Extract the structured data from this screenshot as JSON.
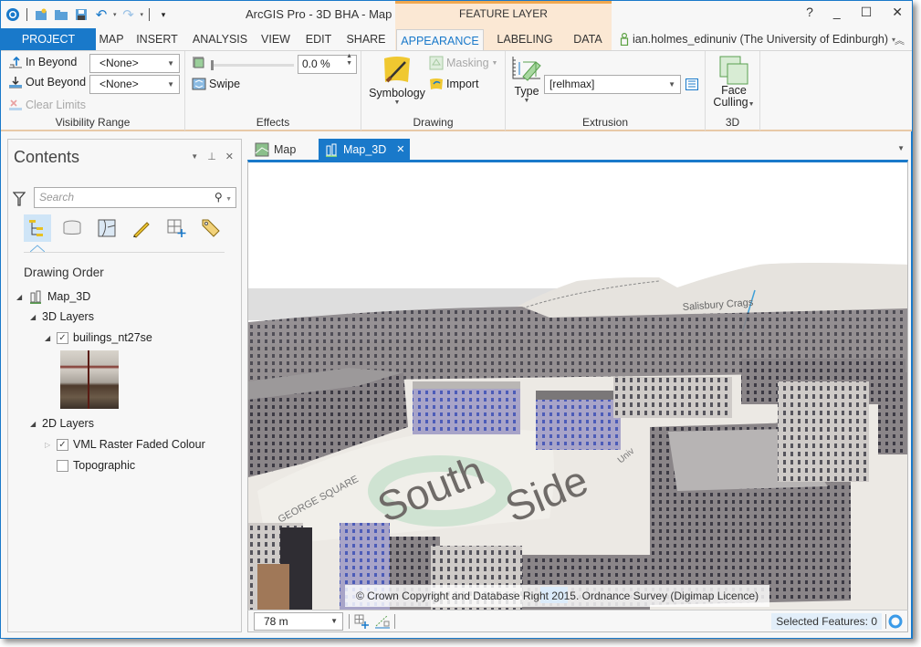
{
  "window": {
    "title": "ArcGIS Pro - 3D BHA - Map",
    "contextual_tab_group": "FEATURE LAYER",
    "controls": {
      "help": "?",
      "minimize": "_",
      "maximize": "☐",
      "close": "✕"
    },
    "qat_icons": [
      "arcgis-logo-icon",
      "new-project-icon",
      "open-project-icon",
      "save-project-icon",
      "undo-icon",
      "redo-icon",
      "customize-qat-icon"
    ]
  },
  "ribbon_tabs": [
    {
      "label": "PROJECT",
      "state": "project"
    },
    {
      "label": "MAP"
    },
    {
      "label": "INSERT"
    },
    {
      "label": "ANALYSIS"
    },
    {
      "label": "VIEW"
    },
    {
      "label": "EDIT"
    },
    {
      "label": "SHARE"
    },
    {
      "label": "APPEARANCE",
      "state": "active"
    },
    {
      "label": "LABELING"
    },
    {
      "label": "DATA"
    }
  ],
  "user": {
    "label": "ian.holmes_edinuniv (The University of Edinburgh)",
    "dropdown": "▾",
    "collapse": "︽"
  },
  "ribbon": {
    "visibility_range": {
      "label": "Visibility Range",
      "in_beyond": "In Beyond",
      "in_beyond_value": "<None>",
      "out_beyond": "Out Beyond",
      "out_beyond_value": "<None>",
      "clear_limits": "Clear Limits"
    },
    "effects": {
      "label": "Effects",
      "transparency_value": "0.0 %",
      "transparency_percent": 0,
      "swipe": "Swipe"
    },
    "drawing": {
      "label": "Drawing",
      "symbology": "Symbology",
      "masking": "Masking",
      "import": "Import"
    },
    "extrusion": {
      "label": "Extrusion",
      "type": "Type",
      "field_value": "[relhmax]"
    },
    "three_d": {
      "label": "3D",
      "face_culling_line1": "Face",
      "face_culling_line2": "Culling"
    }
  },
  "contents": {
    "title": "Contents",
    "search_placeholder": "Search",
    "section_title": "Drawing Order",
    "view_tabs": [
      "list-by-drawing-order-icon",
      "list-by-data-source-icon",
      "list-by-selection-icon",
      "list-by-editing-icon",
      "list-by-snapping-icon",
      "list-by-labeling-icon"
    ],
    "tree": {
      "map": "Map_3D",
      "layers_3d": "3D Layers",
      "buildings": {
        "label": "builings_nt27se",
        "checked": true
      },
      "layers_2d": "2D Layers",
      "vml": {
        "label": "VML Raster Faded Colour",
        "checked": true
      },
      "topo": {
        "label": "Topographic",
        "checked": false
      }
    }
  },
  "map_view": {
    "tabs": [
      {
        "label": "Map",
        "active": false
      },
      {
        "label": "Map_3D",
        "active": true,
        "close": "✕"
      }
    ],
    "map_labels": [
      "South",
      "Side",
      "Salisbury Crags",
      "GEORGE SQUARE",
      "Univ"
    ],
    "attribution": "© Crown Copyright and Database Right 2015. Ordnance Survey (Digimap Licence)",
    "scale": "78 m",
    "selected_features": "Selected Features: 0"
  },
  "colors": {
    "accent": "#1979ca",
    "contextual": "#fbe8d4",
    "contextual_border": "#f0a850",
    "ribbon_bg": "#f7f7f7"
  }
}
